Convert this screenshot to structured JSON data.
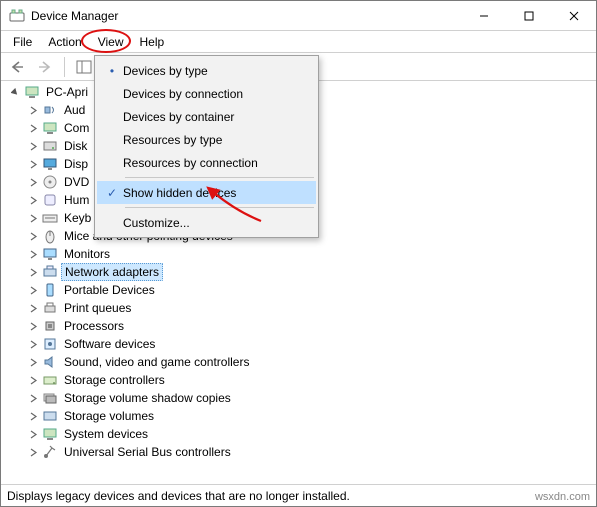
{
  "window": {
    "title": "Device Manager"
  },
  "menubar": {
    "items": [
      "File",
      "Action",
      "View",
      "Help"
    ]
  },
  "view_menu": {
    "items": [
      {
        "label": "Devices by type",
        "checked": "dot",
        "hover": false
      },
      {
        "label": "Devices by connection",
        "checked": "",
        "hover": false
      },
      {
        "label": "Devices by container",
        "checked": "",
        "hover": false
      },
      {
        "label": "Resources by type",
        "checked": "",
        "hover": false
      },
      {
        "label": "Resources by connection",
        "checked": "",
        "hover": false
      }
    ],
    "items2": [
      {
        "label": "Show hidden devices",
        "checked": "check",
        "hover": true
      }
    ],
    "items3": [
      {
        "label": "Customize...",
        "checked": "",
        "hover": false
      }
    ]
  },
  "tree": {
    "root": {
      "label": "PC-Apri"
    },
    "children": [
      {
        "label": "Aud",
        "icon": "audio"
      },
      {
        "label": "Com",
        "icon": "computer"
      },
      {
        "label": "Disk",
        "icon": "disk"
      },
      {
        "label": "Disp",
        "icon": "display"
      },
      {
        "label": "DVD",
        "icon": "dvd"
      },
      {
        "label": "Hum",
        "icon": "hid"
      },
      {
        "label": "Keyb",
        "icon": "keyboard"
      },
      {
        "label": "Mice and other pointing devices",
        "icon": "mouse"
      },
      {
        "label": "Monitors",
        "icon": "monitor"
      },
      {
        "label": "Network adapters",
        "icon": "network",
        "selected": true
      },
      {
        "label": "Portable Devices",
        "icon": "portable"
      },
      {
        "label": "Print queues",
        "icon": "printer"
      },
      {
        "label": "Processors",
        "icon": "cpu"
      },
      {
        "label": "Software devices",
        "icon": "software"
      },
      {
        "label": "Sound, video and game controllers",
        "icon": "sound"
      },
      {
        "label": "Storage controllers",
        "icon": "storage"
      },
      {
        "label": "Storage volume shadow copies",
        "icon": "shadow"
      },
      {
        "label": "Storage volumes",
        "icon": "volume"
      },
      {
        "label": "System devices",
        "icon": "system"
      },
      {
        "label": "Universal Serial Bus controllers",
        "icon": "usb"
      }
    ]
  },
  "statusbar": {
    "text": "Displays legacy devices and devices that are no longer installed."
  },
  "watermark": "wsxdn.com"
}
